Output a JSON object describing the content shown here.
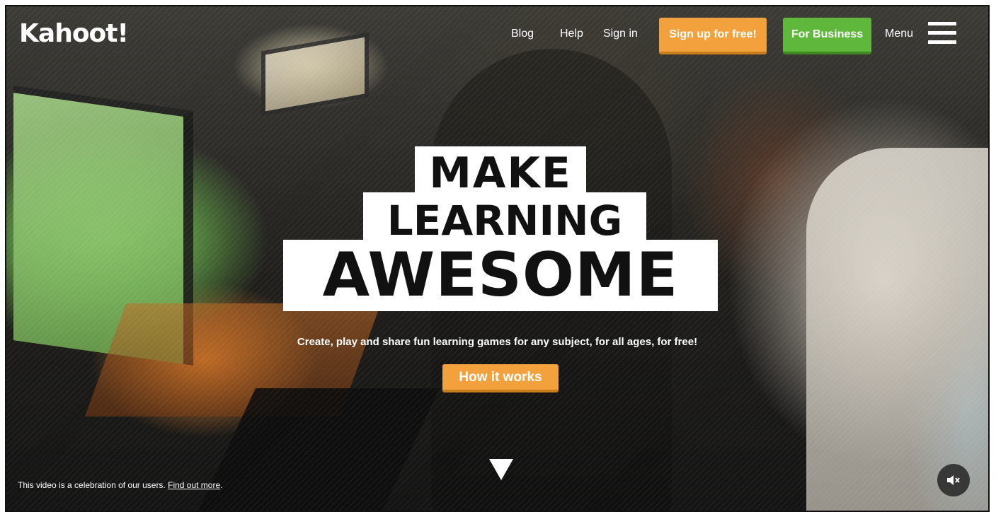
{
  "header": {
    "logo": "Kahoot!",
    "nav": {
      "blog": "Blog",
      "help": "Help",
      "sign_in": "Sign in"
    },
    "signup_label": "Sign up for free!",
    "business_label": "For Business",
    "menu_label": "Menu"
  },
  "hero": {
    "headline_line1": "MAKE",
    "headline_line2": "LEARNING",
    "headline_line3": "AWESOME",
    "tagline": "Create, play and share fun learning games for any subject, for all ages, for free!",
    "cta_label": "How it works"
  },
  "footer": {
    "note": "This video is a celebration of our users. ",
    "link": "Find out more",
    "note_end": "."
  },
  "colors": {
    "orange": "#f2a13c",
    "green": "#5fb83b"
  },
  "icons": {
    "menu": "hamburger-icon",
    "scroll": "down-arrow-icon",
    "sound": "mute-icon"
  }
}
